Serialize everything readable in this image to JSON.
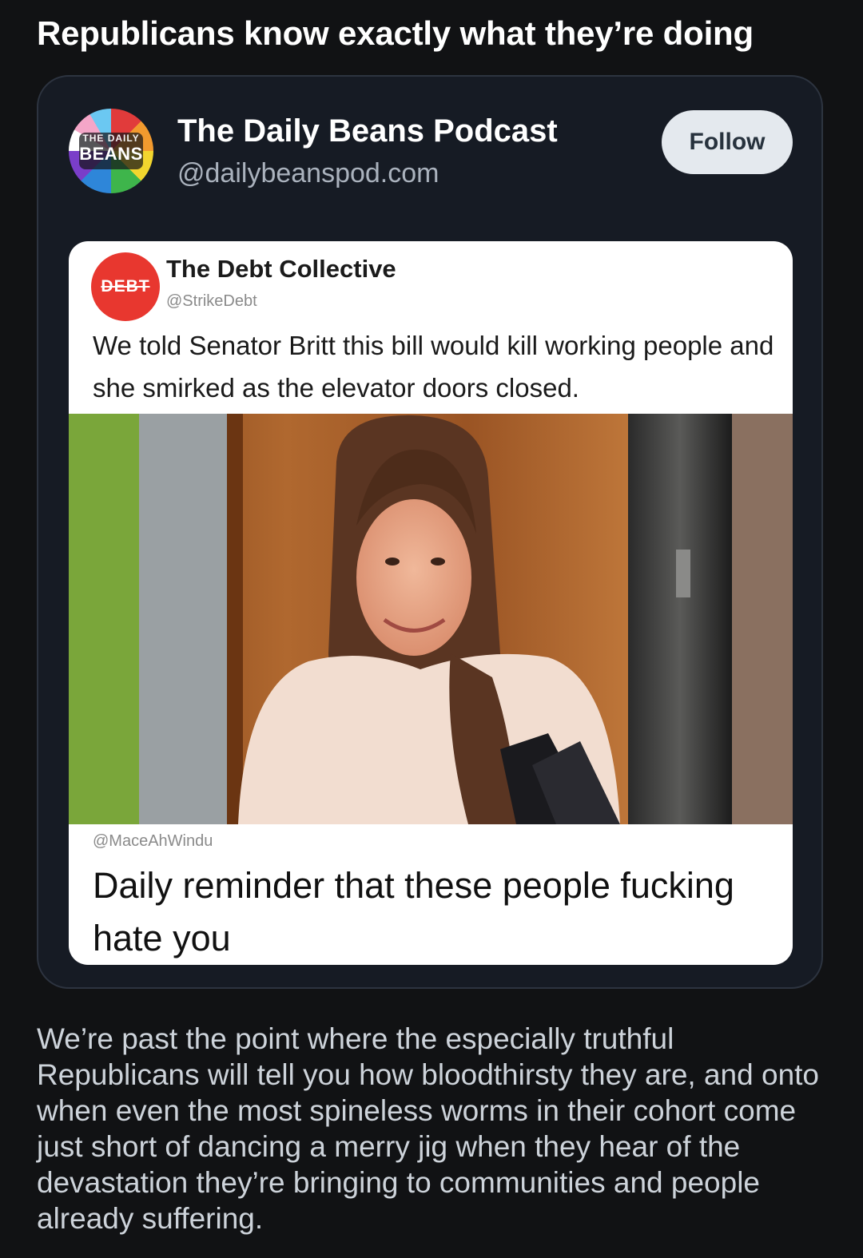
{
  "post": {
    "title": "Republicans know exactly what they’re doing",
    "commentary": "We’re past the point where the especially truthful Republicans will tell you how bloodthirsty they are, and onto when even the most spineless worms in their cohort come just short of dancing a merry jig when they hear of the devastation they’re bringing to communities and people already suffering."
  },
  "embed": {
    "account_name": "The Daily Beans Podcast",
    "account_handle": "@dailybeanspod.com",
    "avatar_logo_lines": [
      "THE DAILY",
      "BEANS"
    ],
    "follow_label": "Follow",
    "screenshot": {
      "source_name": "The Debt Collective",
      "source_handle": "@StrikeDebt",
      "source_logo_text": "DEBT",
      "source_text": "We told Senator Britt this bill would kill working people and she smirked as the elevator doors closed.",
      "meme_handle": "@MaceAhWindu",
      "meme_text": "Daily reminder that these people fucking hate you"
    }
  },
  "colors": {
    "background": "#111214",
    "card_background": "#161b24",
    "card_border": "#2d3440",
    "follow_button": "#e4e9ee",
    "debt_logo_red": "#e8372f"
  }
}
